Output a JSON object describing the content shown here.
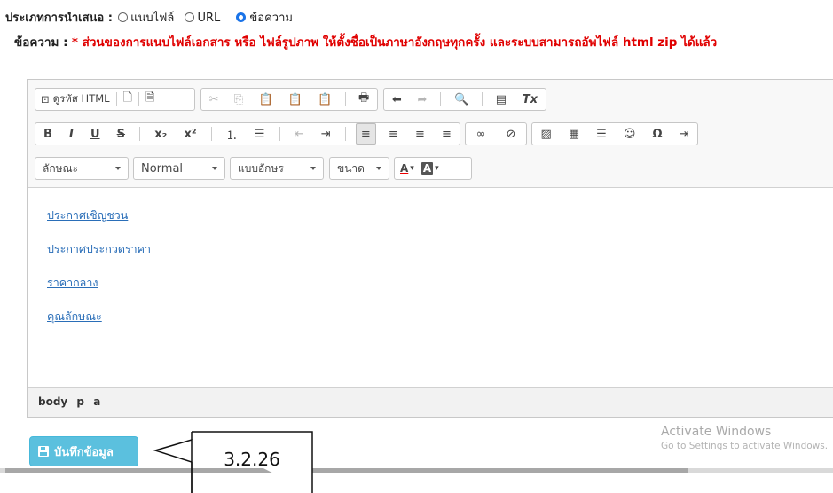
{
  "form": {
    "type_label": "ประเภทการนำเสนอ :",
    "options": [
      "แนบไฟล์",
      "URL",
      "ข้อความ"
    ],
    "selected_option": "ข้อความ",
    "note_label": "ข้อความ :",
    "note_text": "* ส่วนของการแนบไฟล์เอกสาร หรือ ไฟล์รูปภาพ ให้ตั้งชื่อเป็นภาษาอังกฤษทุกครั้ง และระบบสามารถอัพไฟล์ html zip ได้แล้ว"
  },
  "toolbar": {
    "source_label": "ดูรหัส HTML",
    "source_icon": "⊡",
    "row1_icons": [
      {
        "name": "new-page-icon",
        "glyph": "🗋",
        "enabled": true
      },
      {
        "name": "preview-icon",
        "glyph": "🗎",
        "enabled": true
      },
      {
        "name": "cut-icon",
        "glyph": "✂",
        "enabled": false
      },
      {
        "name": "copy-icon",
        "glyph": "⎘",
        "enabled": false
      },
      {
        "name": "paste-icon",
        "glyph": "📋",
        "enabled": true
      },
      {
        "name": "paste-text-icon",
        "glyph": "📋",
        "enabled": true
      },
      {
        "name": "paste-word-icon",
        "glyph": "📋",
        "enabled": true
      },
      {
        "name": "print-icon",
        "glyph": "🖶",
        "enabled": true
      },
      {
        "name": "undo-icon",
        "glyph": "⬅",
        "enabled": true
      },
      {
        "name": "redo-icon",
        "glyph": "➦",
        "enabled": false
      },
      {
        "name": "find-icon",
        "glyph": "🔍",
        "enabled": true
      },
      {
        "name": "select-all-icon",
        "glyph": "▤",
        "enabled": true
      },
      {
        "name": "remove-format-icon",
        "glyph": "Tx",
        "enabled": true
      }
    ],
    "row2_icons": [
      {
        "name": "bold-icon",
        "glyph": "B"
      },
      {
        "name": "italic-icon",
        "glyph": "I"
      },
      {
        "name": "underline-icon",
        "glyph": "U"
      },
      {
        "name": "strike-icon",
        "glyph": "S"
      },
      {
        "name": "subscript-icon",
        "glyph": "x₂"
      },
      {
        "name": "superscript-icon",
        "glyph": "x²"
      },
      {
        "name": "numbered-list-icon",
        "glyph": "⒈"
      },
      {
        "name": "bulleted-list-icon",
        "glyph": "☰"
      },
      {
        "name": "outdent-icon",
        "glyph": "⇤"
      },
      {
        "name": "indent-icon",
        "glyph": "⇥"
      },
      {
        "name": "align-left-icon",
        "glyph": "≡"
      },
      {
        "name": "align-center-icon",
        "glyph": "≡"
      },
      {
        "name": "align-right-icon",
        "glyph": "≡"
      },
      {
        "name": "align-justify-icon",
        "glyph": "≡"
      },
      {
        "name": "link-icon",
        "glyph": "∞"
      },
      {
        "name": "unlink-icon",
        "glyph": "⊘"
      },
      {
        "name": "image-icon",
        "glyph": "▨"
      },
      {
        "name": "table-icon",
        "glyph": "▦"
      },
      {
        "name": "horizontal-rule-icon",
        "glyph": "☰"
      },
      {
        "name": "smiley-icon",
        "glyph": "☺"
      },
      {
        "name": "special-char-icon",
        "glyph": "Ω"
      },
      {
        "name": "page-break-icon",
        "glyph": "⇥"
      }
    ],
    "combos": {
      "styles": "ลักษณะ",
      "format": "Normal",
      "font": "แบบอักษร",
      "size": "ขนาด",
      "text_color": "A",
      "bg_color": "A"
    }
  },
  "content": {
    "links": [
      "ประกาศเชิญชวน",
      "ประกาศประกวดราคา",
      "ราคากลาง",
      "คุณลักษณะ"
    ]
  },
  "statusbar": {
    "path": "body p a"
  },
  "save_button": {
    "label": "บันทึกข้อมูล",
    "color": "#5bc0de"
  },
  "callout": {
    "label": "3.2.26"
  },
  "watermark": {
    "title": "Activate Windows",
    "subtitle": "Go to Settings to activate Windows."
  }
}
